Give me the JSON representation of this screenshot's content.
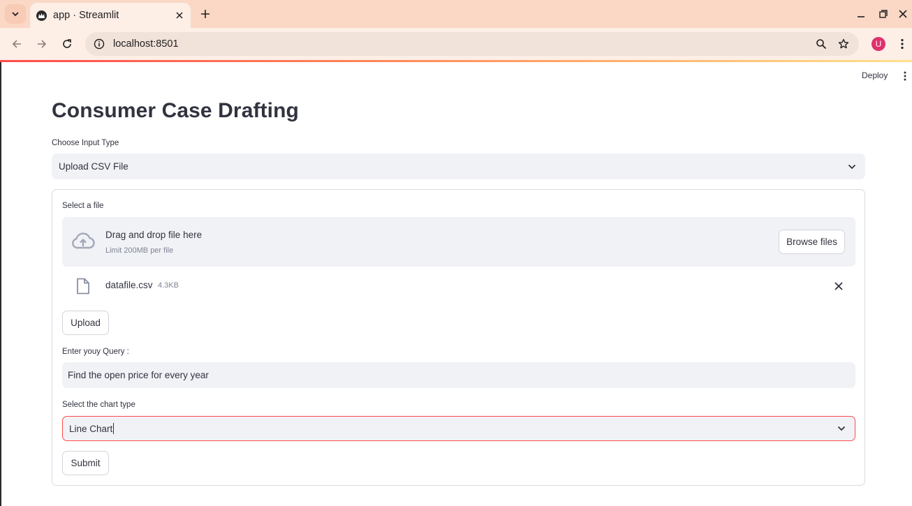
{
  "browser": {
    "tab_title": "app · Streamlit",
    "url_host": "localhost",
    "url_port": ":8501",
    "profile_initial": "U"
  },
  "header": {
    "deploy_label": "Deploy"
  },
  "main": {
    "title": "Consumer Case Drafting",
    "input_type": {
      "label": "Choose Input Type",
      "value": "Upload CSV File"
    },
    "uploader": {
      "label": "Select a file",
      "drop_text": "Drag and drop file here",
      "limit_text": "Limit 200MB per file",
      "browse_label": "Browse files",
      "file_name": "datafile.csv",
      "file_size": "4.3KB"
    },
    "upload_button": "Upload",
    "query": {
      "label": "Enter youy Query :",
      "value": "Find the open price for every year"
    },
    "chart_type": {
      "label": "Select the chart type",
      "value": "Line Chart"
    },
    "submit_button": "Submit"
  },
  "colors": {
    "accent": "#ff4b4b",
    "tabbar": "#fbd8c6",
    "input_bg": "#f0f2f6",
    "text": "#31333f"
  }
}
